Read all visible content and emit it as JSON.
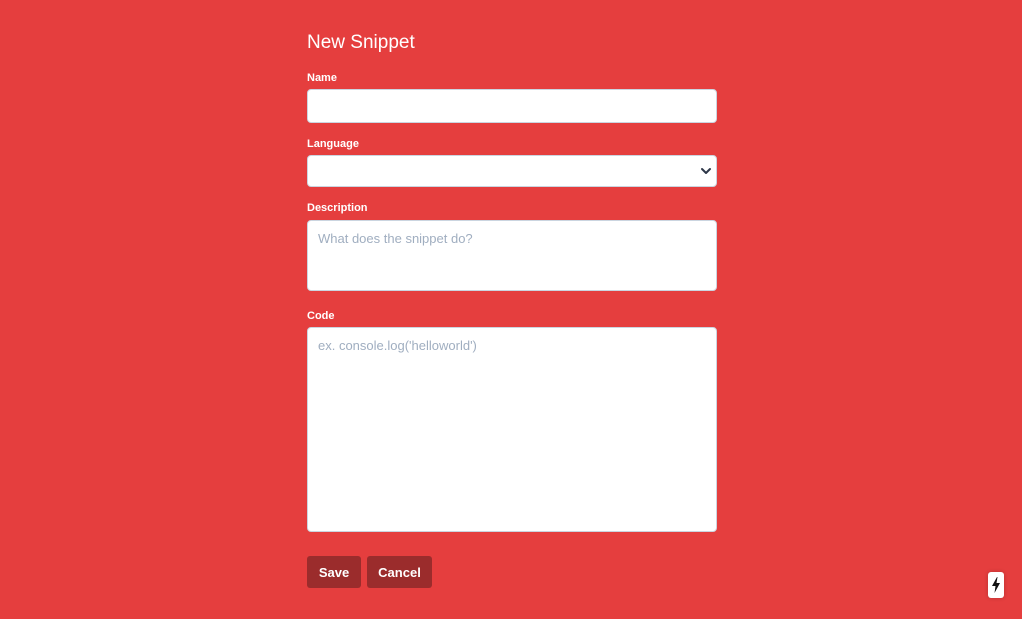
{
  "form": {
    "title": "New Snippet",
    "name": {
      "label": "Name",
      "value": "",
      "placeholder": ""
    },
    "language": {
      "label": "Language",
      "selected": ""
    },
    "description": {
      "label": "Description",
      "value": "",
      "placeholder": "What does the snippet do?"
    },
    "code": {
      "label": "Code",
      "value": "",
      "placeholder": "ex. console.log('helloworld')"
    }
  },
  "actions": {
    "save_label": "Save",
    "cancel_label": "Cancel"
  },
  "colors": {
    "background": "#e53e3e",
    "button": "#9b2c2c",
    "field": "#ffffff",
    "placeholder": "#a0aec0"
  },
  "icons": {
    "select_arrow": "chevron-down-icon",
    "corner_badge": "lightning-bolt-icon"
  }
}
